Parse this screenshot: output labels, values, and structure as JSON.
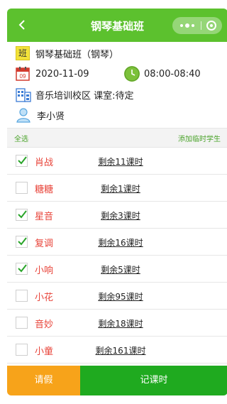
{
  "header": {
    "title": "钢琴基础班"
  },
  "info": {
    "class_name": "钢琴基础班（钢琴）",
    "class_icon_text": "班",
    "calendar_day": "09",
    "date": "2020-11-09",
    "time": "08:00-08:40",
    "location": "音乐培训校区 课室:待定",
    "teacher": "李小贤"
  },
  "toolbar": {
    "select_all": "全选",
    "add_temp": "添加临时学生"
  },
  "students": [
    {
      "name": "肖战",
      "lessons": "剩余11课时",
      "checked": true
    },
    {
      "name": "糖糖",
      "lessons": "剩余1课时",
      "checked": false
    },
    {
      "name": "星音",
      "lessons": "剩余3课时",
      "checked": true
    },
    {
      "name": "复调",
      "lessons": "剩余16课时",
      "checked": true
    },
    {
      "name": "小响",
      "lessons": "剩余5课时",
      "checked": true
    },
    {
      "name": "小花",
      "lessons": "剩余95课时",
      "checked": false
    },
    {
      "name": "音妙",
      "lessons": "剩余18课时",
      "checked": false
    },
    {
      "name": "小童",
      "lessons": "剩余161课时",
      "checked": false
    }
  ],
  "bottom": {
    "leave": "请假",
    "record": "记课时"
  },
  "colors": {
    "header_green": "#5cc12e",
    "name_red": "#e8443a",
    "leave_orange": "#f7a31a",
    "record_green": "#1faa1f"
  }
}
